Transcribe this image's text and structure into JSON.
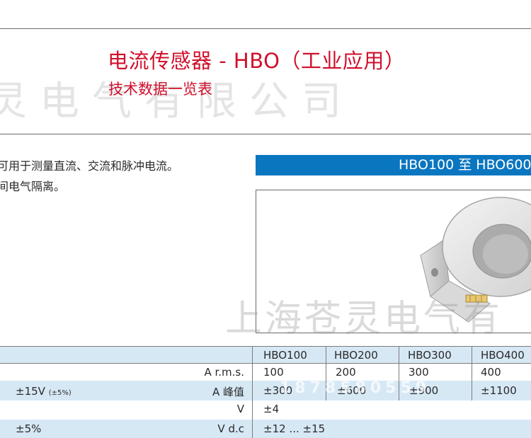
{
  "header": {
    "title": "电流传感器 - HBO（工业应用）",
    "subtitle": "技术数据一览表"
  },
  "watermarks": {
    "top": "灵电气有限公司",
    "image": "上海苍灵电气有",
    "digits": "1878580559"
  },
  "intro": {
    "line1": "可用于测量直流、交流和脉冲电流。",
    "line2": "间电气隔离。"
  },
  "model_bar": {
    "label": "HBO100 至 HBO600"
  },
  "table": {
    "columns": [
      "HBO100",
      "HBO200",
      "HBO300",
      "HBO400"
    ],
    "rows": [
      {
        "param": "",
        "param_note": "",
        "unit": "A r.m.s.",
        "values": [
          "100",
          "200",
          "300",
          "400"
        ]
      },
      {
        "param": "±15V",
        "param_note": "(±5%)",
        "unit": "A 峰值",
        "values": [
          "±300",
          "±600",
          "±900",
          "±1100"
        ]
      },
      {
        "param": "",
        "param_note": "",
        "unit": "V",
        "values": [
          "±4"
        ]
      },
      {
        "param": "±5%",
        "param_note": "",
        "unit": "V d.c",
        "values": [
          "±12 ... ±15"
        ]
      }
    ]
  },
  "colors": {
    "title_red": "#d0102c",
    "model_bar_blue": "#0a76c0",
    "table_shade": "#d7e8f5"
  }
}
